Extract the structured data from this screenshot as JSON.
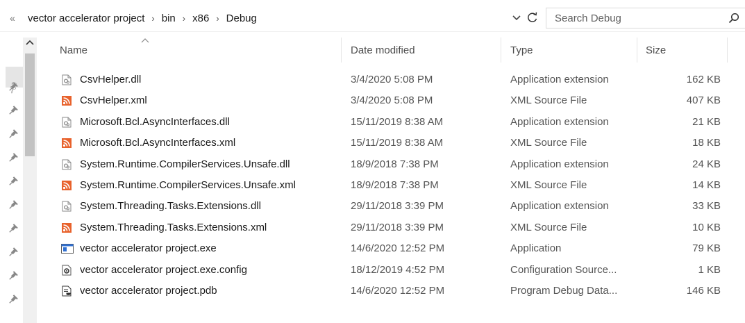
{
  "breadcrumb": {
    "overflow": "«",
    "items": [
      "vector accelerator project",
      "bin",
      "x86",
      "Debug"
    ],
    "separator": "›"
  },
  "search": {
    "placeholder": "Search Debug"
  },
  "columns": {
    "name": "Name",
    "date": "Date modified",
    "type": "Type",
    "size": "Size"
  },
  "files": [
    {
      "name": "CsvHelper.dll",
      "date": "3/4/2020 5:08 PM",
      "type": "Application extension",
      "size": "162 KB",
      "icon": "dll-icon"
    },
    {
      "name": "CsvHelper.xml",
      "date": "3/4/2020 5:08 PM",
      "type": "XML Source File",
      "size": "407 KB",
      "icon": "xml-icon"
    },
    {
      "name": "Microsoft.Bcl.AsyncInterfaces.dll",
      "date": "15/11/2019 8:38 AM",
      "type": "Application extension",
      "size": "21 KB",
      "icon": "dll-icon"
    },
    {
      "name": "Microsoft.Bcl.AsyncInterfaces.xml",
      "date": "15/11/2019 8:38 AM",
      "type": "XML Source File",
      "size": "18 KB",
      "icon": "xml-icon"
    },
    {
      "name": "System.Runtime.CompilerServices.Unsafe.dll",
      "date": "18/9/2018 7:38 PM",
      "type": "Application extension",
      "size": "24 KB",
      "icon": "dll-icon"
    },
    {
      "name": "System.Runtime.CompilerServices.Unsafe.xml",
      "date": "18/9/2018 7:38 PM",
      "type": "XML Source File",
      "size": "14 KB",
      "icon": "xml-icon"
    },
    {
      "name": "System.Threading.Tasks.Extensions.dll",
      "date": "29/11/2018 3:39 PM",
      "type": "Application extension",
      "size": "33 KB",
      "icon": "dll-icon"
    },
    {
      "name": "System.Threading.Tasks.Extensions.xml",
      "date": "29/11/2018 3:39 PM",
      "type": "XML Source File",
      "size": "10 KB",
      "icon": "xml-icon"
    },
    {
      "name": "vector accelerator project.exe",
      "date": "14/6/2020 12:52 PM",
      "type": "Application",
      "size": "79 KB",
      "icon": "exe-icon"
    },
    {
      "name": "vector accelerator project.exe.config",
      "date": "18/12/2019 4:52 PM",
      "type": "Configuration Source...",
      "size": "1 KB",
      "icon": "config-icon"
    },
    {
      "name": "vector accelerator project.pdb",
      "date": "14/6/2020 12:52 PM",
      "type": "Program Debug Data...",
      "size": "146 KB",
      "icon": "pdb-icon"
    }
  ],
  "colors": {
    "xml_icon": "#e8622c",
    "exe_icon": "#2f6fd1",
    "dll_icon": "#9a9a9a"
  }
}
